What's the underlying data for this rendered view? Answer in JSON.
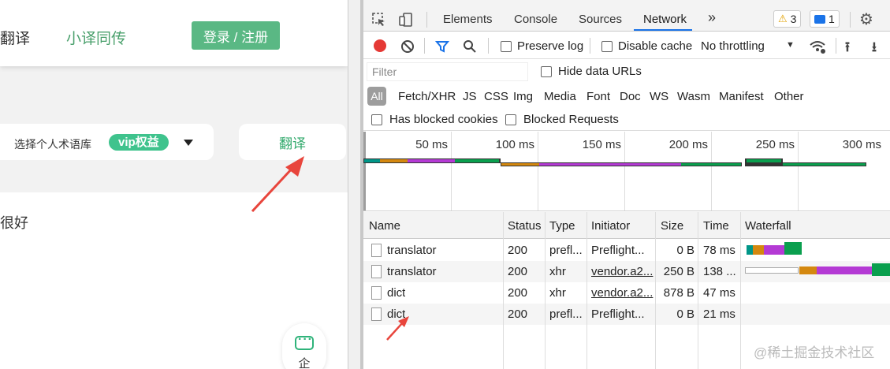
{
  "page": {
    "nav_cut_text": "翻译",
    "nav_link": "小译同传",
    "login_button": "登录 / 注册",
    "corpus_label": "选择个人术语库",
    "vip_badge": "vip权益",
    "translate_button": "翻译",
    "result_cut_text": "很好",
    "chat_text": "企"
  },
  "devtools": {
    "tabs": [
      "Elements",
      "Console",
      "Sources",
      "Network"
    ],
    "active_tab": "Network",
    "more_tabs": "»",
    "warning_count": "3",
    "message_count": "1",
    "toolbar": {
      "preserve_log": "Preserve log",
      "disable_cache": "Disable cache",
      "throttling": "No throttling"
    },
    "filter_placeholder": "Filter",
    "hide_data_urls": "Hide data URLs",
    "types": [
      "All",
      "Fetch/XHR",
      "JS",
      "CSS",
      "Img",
      "Media",
      "Font",
      "Doc",
      "WS",
      "Wasm",
      "Manifest",
      "Other"
    ],
    "has_blocked_cookies": "Has blocked cookies",
    "blocked_requests": "Blocked Requests",
    "overview_ticks": [
      "50 ms",
      "100 ms",
      "150 ms",
      "200 ms",
      "250 ms",
      "300 ms"
    ],
    "columns": [
      "Name",
      "Status",
      "Type",
      "Initiator",
      "Size",
      "Time",
      "Waterfall"
    ],
    "rows": [
      {
        "name": "translator",
        "status": "200",
        "type": "prefl...",
        "initiator": "Preflight...",
        "size": "0 B",
        "time": "78 ms"
      },
      {
        "name": "translator",
        "status": "200",
        "type": "xhr",
        "initiator": "vendor.a2...",
        "size": "250 B",
        "time": "138 ..."
      },
      {
        "name": "dict",
        "status": "200",
        "type": "xhr",
        "initiator": "vendor.a2...",
        "size": "878 B",
        "time": "47 ms"
      },
      {
        "name": "dict",
        "status": "200",
        "type": "prefl...",
        "initiator": "Preflight...",
        "size": "0 B",
        "time": "21 ms"
      }
    ]
  },
  "watermark": "@稀土掘金技术社区",
  "colors": {
    "green": "#5ab884",
    "accent_green": "#2fa86a",
    "red_arrow": "#e8453c",
    "wf_queue": "#009688",
    "wf_orange": "#d4880f",
    "wf_purple": "#b43ad4",
    "wf_green": "#0a9f4e"
  }
}
